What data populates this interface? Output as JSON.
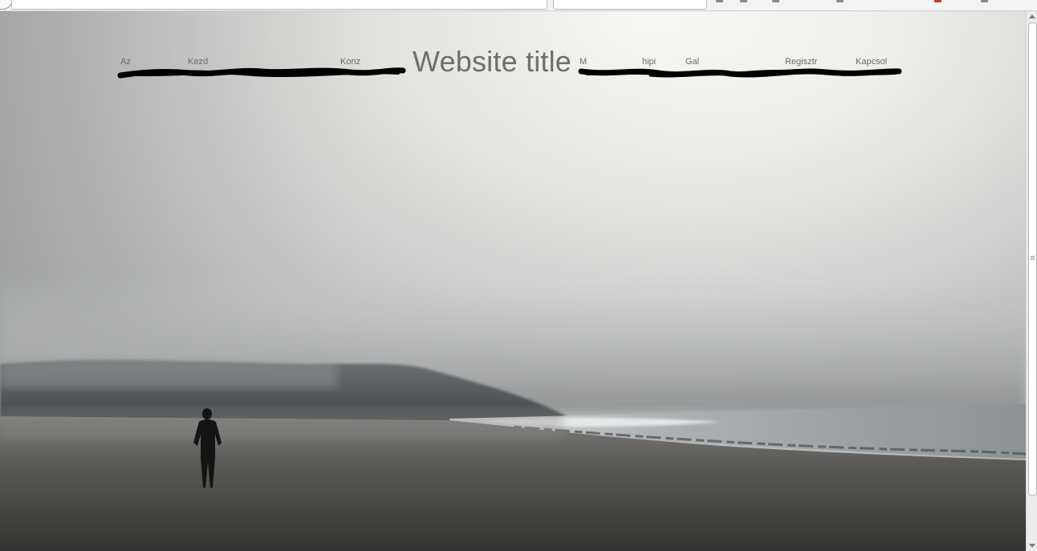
{
  "browser": {
    "toolbar_icons": [
      "bookmark-icon",
      "download-icon",
      "home-icon",
      "pocket-icon",
      "extension-icon",
      "menu-icon"
    ]
  },
  "header": {
    "site_title": "Website title",
    "nav_left_items": [
      "Az",
      "Kezd",
      "Konz"
    ],
    "nav_right_items": [
      "M",
      "hipi",
      "Gal",
      "Regisztr",
      "Kapcsol"
    ],
    "redaction": "scribbled-out"
  },
  "colors": {
    "title": "#6e6e6e",
    "sky": "#f3f4ef",
    "sand": "#4a4845",
    "scribble": "#000000"
  },
  "hero": {
    "description_icon": "foggy-beach-image"
  }
}
